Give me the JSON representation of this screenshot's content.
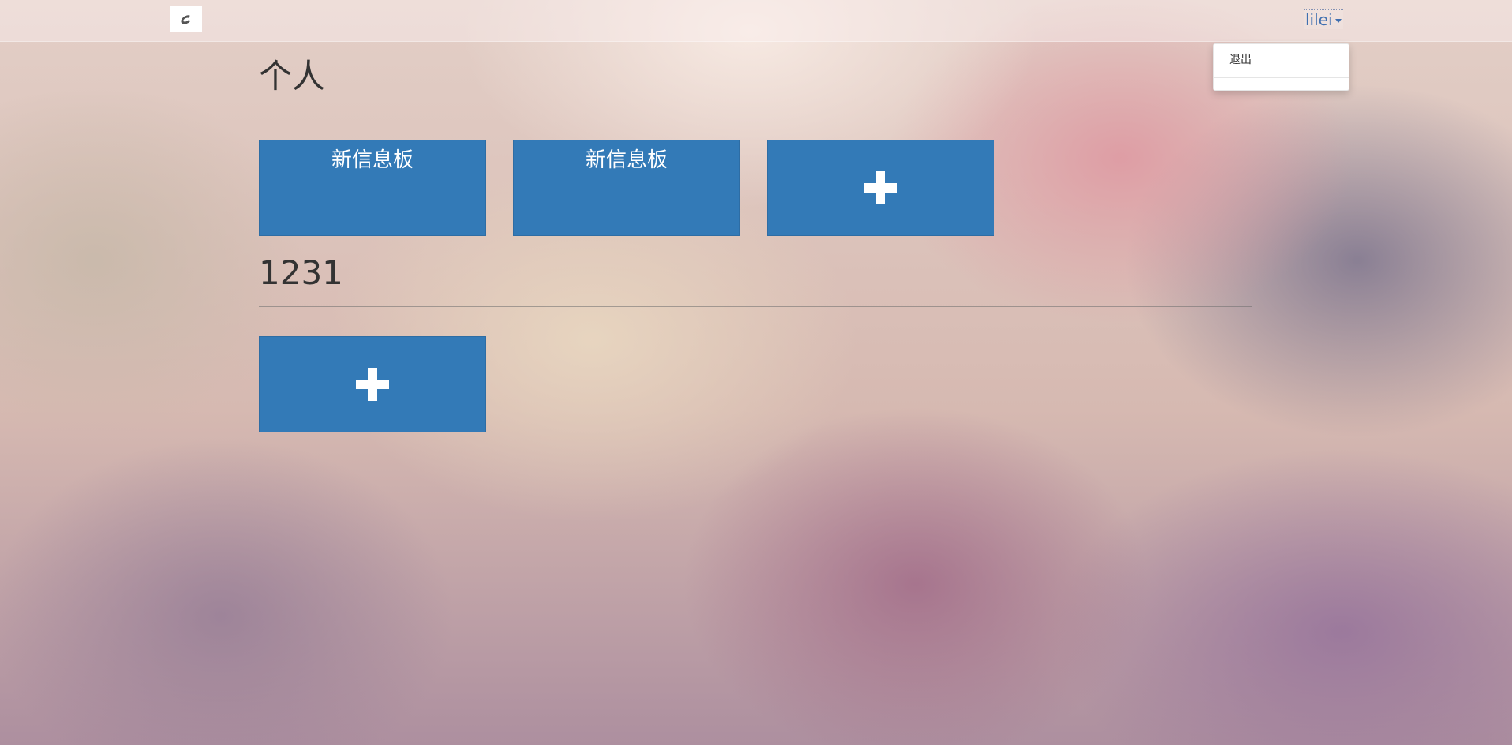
{
  "navbar": {
    "brand_icon": "app-logo-icon",
    "username": "lilei"
  },
  "user_menu": {
    "items": [
      {
        "label": "退出"
      }
    ]
  },
  "sections": [
    {
      "title": "个人",
      "boards": [
        {
          "label": "新信息板"
        },
        {
          "label": "新信息板"
        }
      ],
      "add_icon": "plus-icon"
    },
    {
      "title": "1231",
      "boards": [],
      "add_icon": "plus-icon"
    }
  ],
  "colors": {
    "tile": "#337ab7",
    "link": "#3f6fb0",
    "heading": "#333333"
  }
}
